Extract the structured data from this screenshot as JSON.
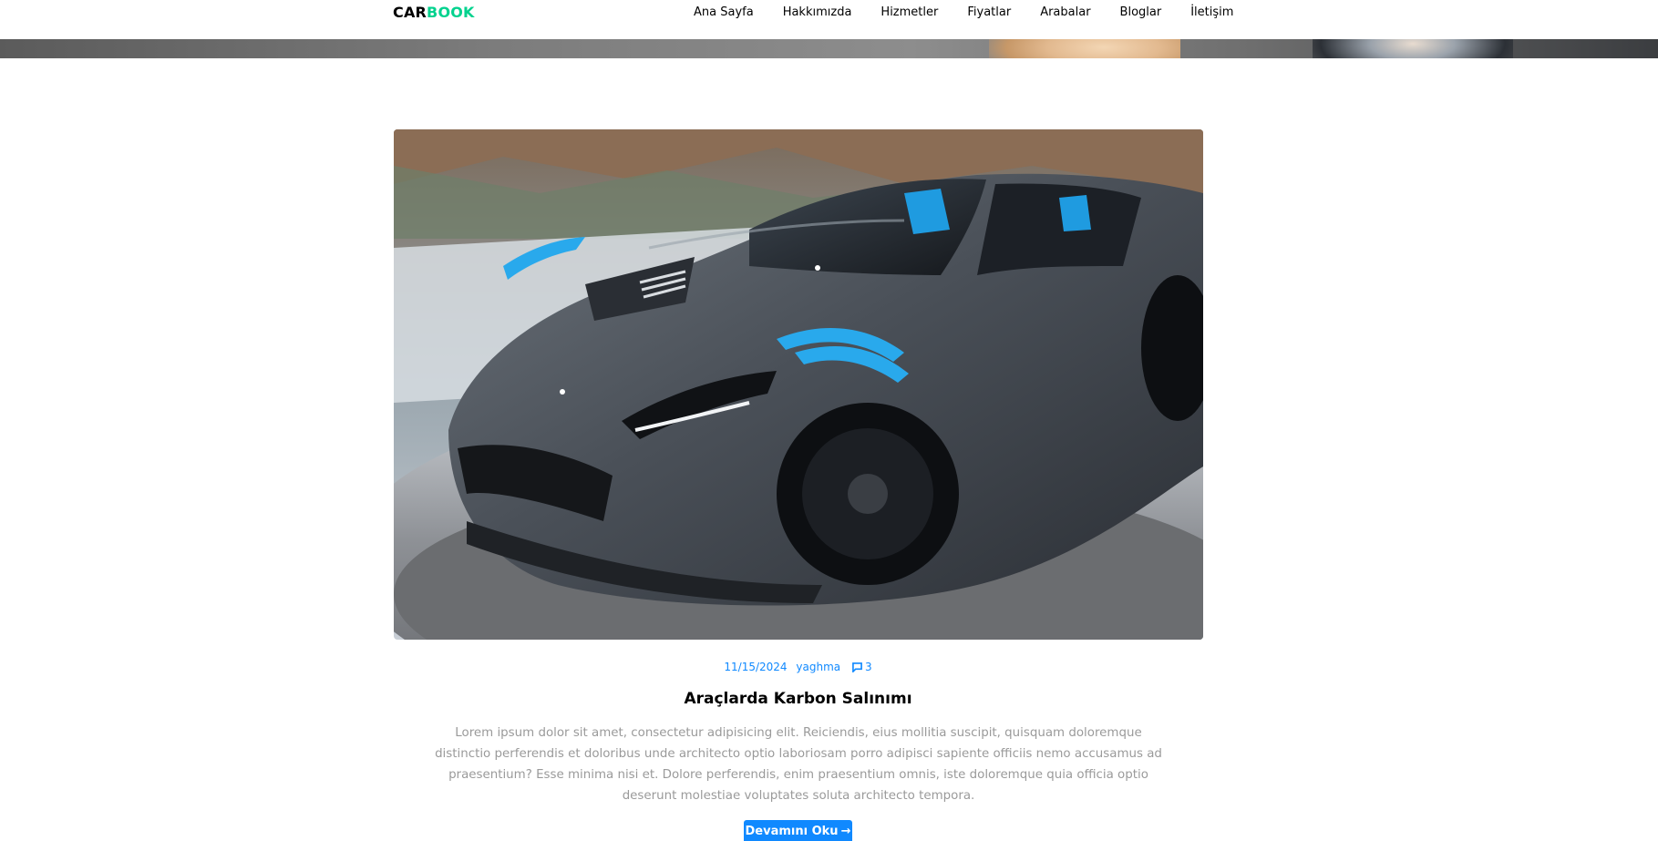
{
  "brand": {
    "part1": "CAR",
    "part2": "BOOK"
  },
  "nav": {
    "items": [
      {
        "label": "Ana Sayfa"
      },
      {
        "label": "Hakkımızda"
      },
      {
        "label": "Hizmetler"
      },
      {
        "label": "Fiyatlar"
      },
      {
        "label": "Arabalar"
      },
      {
        "label": "Bloglar"
      },
      {
        "label": "İletişim"
      }
    ]
  },
  "post": {
    "date": "11/15/2024",
    "author": "yaghma",
    "comment_icon": "chat-icon",
    "comments": "3",
    "title": "Araçlarda Karbon Salınımı",
    "excerpt": "Lorem ipsum dolor sit amet, consectetur adipisicing elit. Reiciendis, eius mollitia suscipit, quisquam doloremque distinctio perferendis et doloribus unde architecto optio laboriosam porro adipisci sapiente officiis nemo accusamus ad praesentium? Esse minima nisi et. Dolore perferendis, enim praesentium omnis, iste doloremque quia officia optio deserunt molestiae voluptates soluta architecto tempora.",
    "read_more": "Devamını Oku",
    "read_more_icon": "arrow-right-icon"
  },
  "colors": {
    "accent": "#1089ff",
    "brand_green": "#01d28e",
    "muted_text": "#9a9a9a"
  }
}
